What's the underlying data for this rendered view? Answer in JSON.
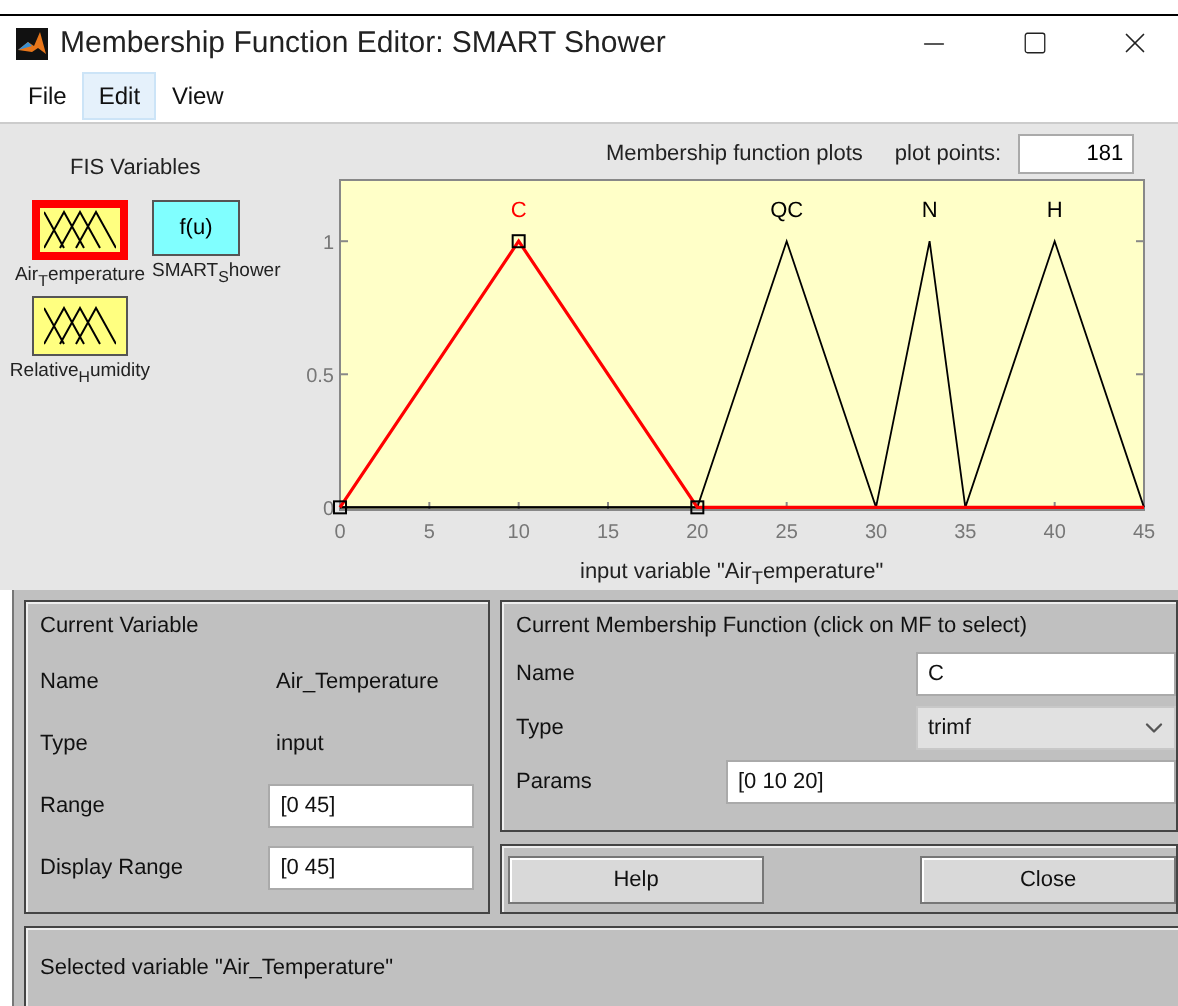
{
  "window": {
    "title": "Membership Function Editor: SMART Shower"
  },
  "menu": [
    {
      "label": "File",
      "selected": false
    },
    {
      "label": "Edit",
      "selected": true
    },
    {
      "label": "View",
      "selected": false
    }
  ],
  "fis_variables": {
    "title": "FIS Variables",
    "variables": [
      {
        "label": "Air$_{T}$emperature",
        "kind": "input",
        "selected": true
      },
      {
        "label": "SMART$_{S}$hower",
        "kind": "output",
        "symbol": "f(u)",
        "selected": false
      },
      {
        "label": "Relative$_{H}$umidity",
        "kind": "input",
        "selected": false
      }
    ]
  },
  "plot": {
    "title": "Membership function plots",
    "plot_points_label": "plot points:",
    "plot_points": "181",
    "chart_data": {
      "type": "line",
      "xlabel": "input variable \"Air$_{T}$emperature\"",
      "x": [
        0,
        10,
        20,
        25,
        30,
        33,
        35,
        40,
        45
      ],
      "series": [
        {
          "name": "QC",
          "color": "#000000",
          "values": [
            0,
            0,
            0,
            1,
            0,
            0,
            0,
            0,
            0
          ]
        },
        {
          "name": "N",
          "color": "#000000",
          "values": [
            0,
            0,
            0,
            0,
            0,
            1,
            0,
            0,
            0
          ]
        },
        {
          "name": "H",
          "color": "#000000",
          "values": [
            0,
            0,
            0,
            0,
            0,
            0,
            0,
            1,
            0
          ]
        },
        {
          "name": "C",
          "color": "#ff0000",
          "values": [
            0,
            1,
            0,
            0,
            0,
            0,
            0,
            0,
            0
          ]
        }
      ],
      "xlim": [
        0,
        45
      ],
      "ylim": [
        -0.01,
        1.23
      ],
      "xticks": [
        0,
        5,
        10,
        15,
        20,
        25,
        30,
        35,
        40,
        45
      ],
      "yticks": [
        0,
        0.5,
        1
      ]
    },
    "curves": [
      {
        "selected": false
      },
      {
        "selected": false
      },
      {
        "selected": false
      },
      {
        "selected": true
      }
    ]
  },
  "current_variable": {
    "title": "Current Variable",
    "fields": [
      {
        "label": "Name",
        "value": "Air_Temperature",
        "kind": "text"
      },
      {
        "label": "Type",
        "value": "input",
        "kind": "text"
      },
      {
        "label": "Range",
        "value": "[0 45]",
        "kind": "field"
      },
      {
        "label": "Display Range",
        "value": "[0 45]",
        "kind": "field"
      }
    ]
  },
  "current_mf": {
    "title": "Current Membership Function (click on MF to select)",
    "fields": [
      {
        "label": "Name",
        "value": "C",
        "kind": "field"
      },
      {
        "label": "Type",
        "value": "trimf",
        "kind": "dropdown"
      },
      {
        "label": "Params",
        "value": "[0 10 20]",
        "kind": "wide_field"
      }
    ]
  },
  "buttons": [
    "Help",
    "Close"
  ],
  "status": "Selected variable \"Air_Temperature\""
}
